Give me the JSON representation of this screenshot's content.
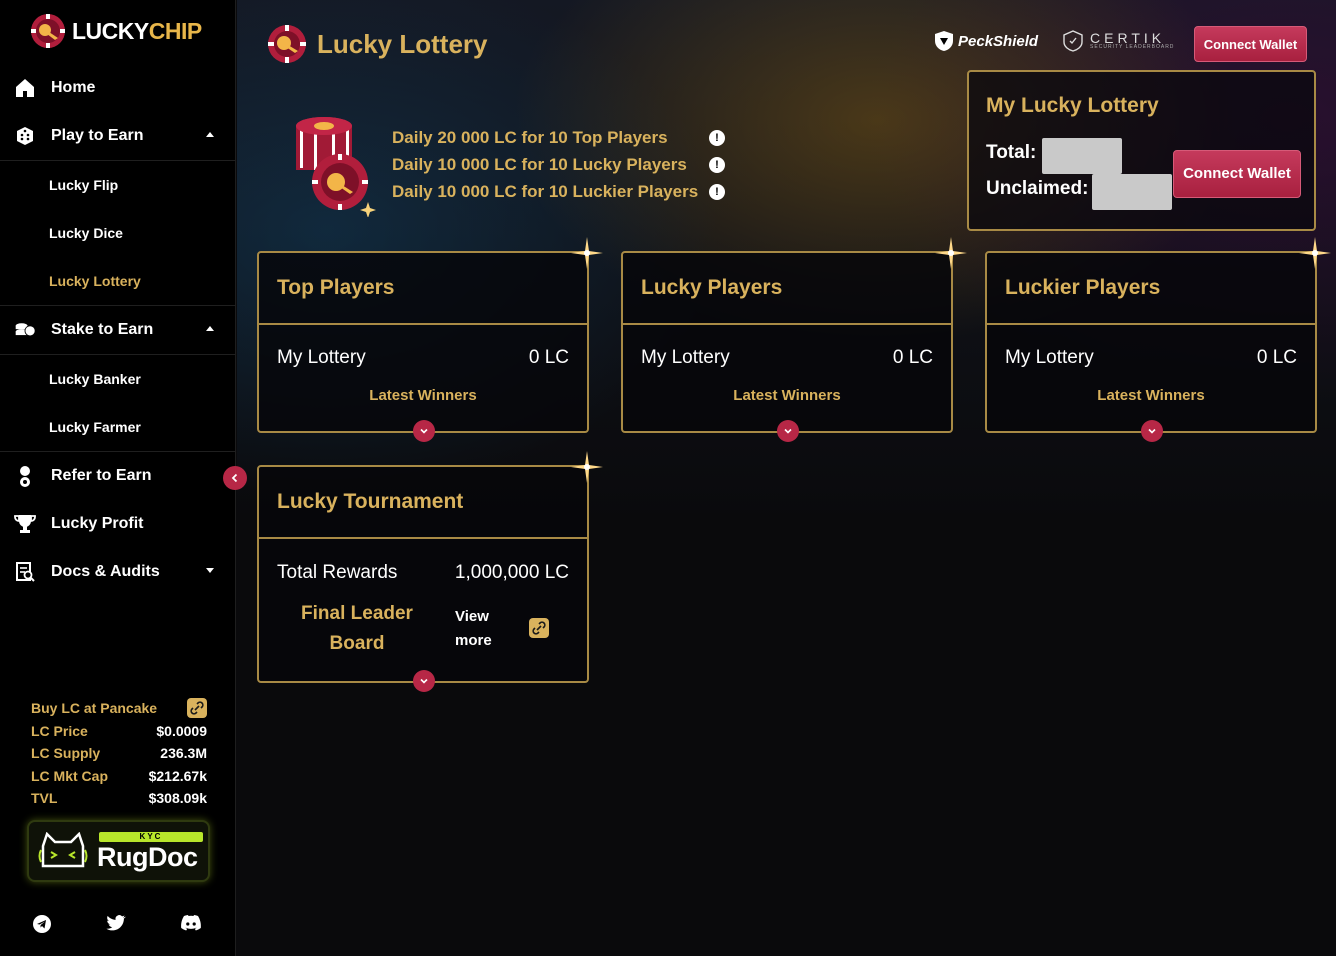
{
  "brand": {
    "name_part1": "LUCKY",
    "name_part2": "CHIP"
  },
  "sidebar": {
    "items": [
      {
        "label": "Home",
        "icon": "home-icon"
      },
      {
        "label": "Play to Earn",
        "icon": "dice-icon",
        "expanded": true,
        "children": [
          "Lucky Flip",
          "Lucky Dice",
          "Lucky Lottery"
        ]
      },
      {
        "label": "Stake to Earn",
        "icon": "coins-icon",
        "expanded": true,
        "children": [
          "Lucky Banker",
          "Lucky Farmer"
        ]
      },
      {
        "label": "Refer to Earn",
        "icon": "referral-icon"
      },
      {
        "label": "Lucky Profit",
        "icon": "trophy-icon"
      },
      {
        "label": "Docs & Audits",
        "icon": "docs-icon",
        "expanded": false
      }
    ],
    "active_child": "Lucky Lottery"
  },
  "stats": {
    "buy_label": "Buy LC at Pancake",
    "rows": [
      {
        "k": "LC Price",
        "v": "$0.0009"
      },
      {
        "k": "LC Supply",
        "v": "236.3M"
      },
      {
        "k": "LC Mkt Cap",
        "v": "$212.67k"
      },
      {
        "k": "TVL",
        "v": "$308.09k"
      }
    ]
  },
  "rugdoc": {
    "kyc": "KYC",
    "name": "RugDoc"
  },
  "socials": [
    "telegram-icon",
    "twitter-icon",
    "discord-icon"
  ],
  "header": {
    "title": "Lucky Lottery",
    "peckshield": "PeckShield",
    "certik": "CERTIK",
    "certik_sub": "SECURITY LEADERBOARD",
    "connect_wallet": "Connect Wallet"
  },
  "promo": [
    "Daily 20 000 LC for 10 Top Players",
    "Daily 10 000 LC for 10 Lucky Players",
    "Daily 10 000 LC for 10 Luckier Players"
  ],
  "my_lottery": {
    "title": "My Lucky Lottery",
    "total_label": "Total:",
    "unclaimed_label": "Unclaimed:",
    "connect_wallet": "Connect Wallet"
  },
  "cards": [
    {
      "title": "Top Players",
      "row_label": "My Lottery",
      "row_value": "0 LC",
      "footer": "Latest Winners"
    },
    {
      "title": "Lucky Players",
      "row_label": "My Lottery",
      "row_value": "0 LC",
      "footer": "Latest Winners"
    },
    {
      "title": "Luckier Players",
      "row_label": "My Lottery",
      "row_value": "0 LC",
      "footer": "Latest Winners"
    }
  ],
  "tournament": {
    "title": "Lucky Tournament",
    "rewards_label": "Total Rewards",
    "rewards_value": "1,000,000 LC",
    "board_label": "Final Leader Board",
    "view_more": "View more"
  },
  "colors": {
    "gold": "#d9b25d",
    "accent": "#b72746",
    "border": "#a88a45"
  }
}
